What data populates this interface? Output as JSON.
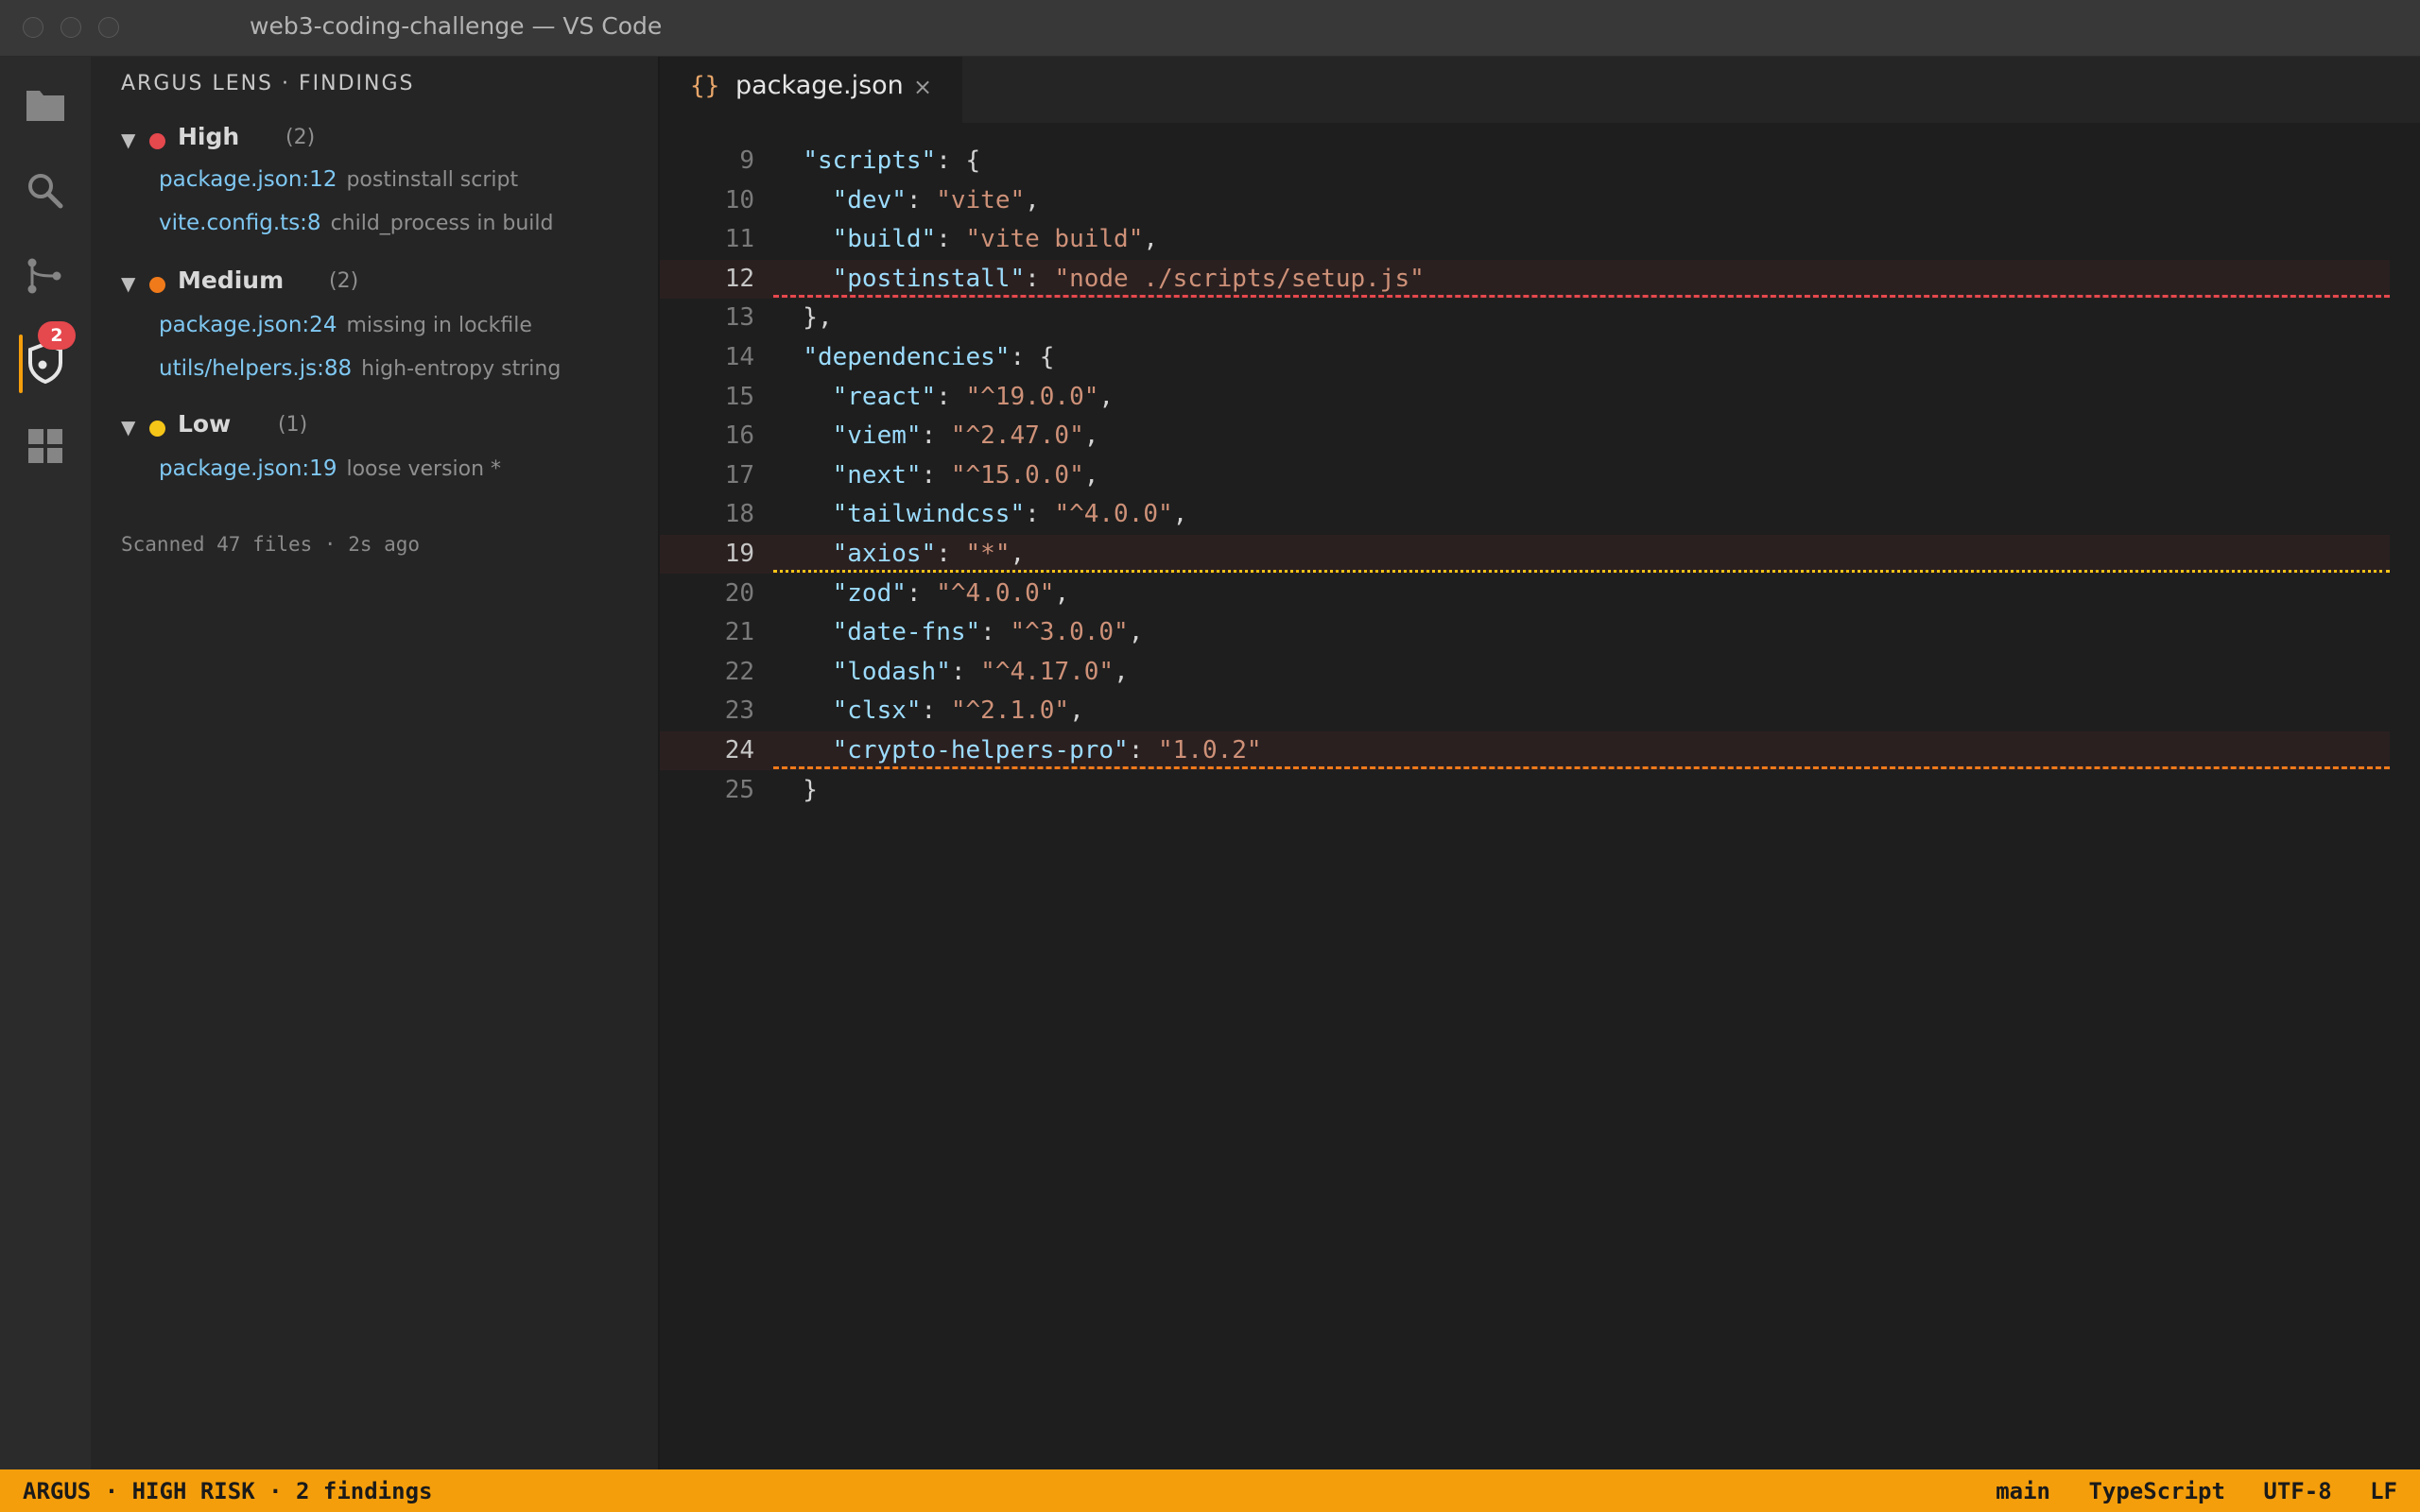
{
  "window": {
    "title": "web3-coding-challenge — VS Code"
  },
  "activity_bar": {
    "items": [
      "files-icon",
      "search-icon",
      "source-control-icon",
      "argus-shield-icon",
      "extensions-icon"
    ],
    "argus_badge": "2"
  },
  "sidebar": {
    "header": "ARGUS LENS · FINDINGS",
    "groups": [
      {
        "label": "High",
        "count": "(2)",
        "color": "#e5484d",
        "items": [
          {
            "location": "package.json:12",
            "description": "postinstall script"
          },
          {
            "location": "vite.config.ts:8",
            "description": "child_process in build"
          }
        ]
      },
      {
        "label": "Medium",
        "count": "(2)",
        "color": "#f07a1a",
        "items": [
          {
            "location": "package.json:24",
            "description": "missing in lockfile"
          },
          {
            "location": "utils/helpers.js:88",
            "description": "high-entropy string"
          }
        ]
      },
      {
        "label": "Low",
        "count": "(1)",
        "color": "#f5c518",
        "items": [
          {
            "location": "package.json:19",
            "description": "loose version *"
          }
        ]
      }
    ],
    "scan_status": "Scanned 47 files · 2s ago"
  },
  "editor": {
    "tab": {
      "icon": "{}",
      "label": "package.json",
      "close": "×"
    },
    "lines": [
      {
        "num": "9",
        "text": "  \"scripts\": {"
      },
      {
        "num": "10",
        "text": "    \"dev\": \"vite\","
      },
      {
        "num": "11",
        "text": "    \"build\": \"vite build\","
      },
      {
        "num": "12",
        "text": "    \"postinstall\": \"node ./scripts/setup.js\"",
        "severity": "high"
      },
      {
        "num": "13",
        "text": "  },"
      },
      {
        "num": "14",
        "text": "  \"dependencies\": {"
      },
      {
        "num": "15",
        "text": "    \"react\": \"^19.0.0\","
      },
      {
        "num": "16",
        "text": "    \"viem\": \"^2.47.0\","
      },
      {
        "num": "17",
        "text": "    \"next\": \"^15.0.0\","
      },
      {
        "num": "18",
        "text": "    \"tailwindcss\": \"^4.0.0\","
      },
      {
        "num": "19",
        "text": "    \"axios\": \"*\",",
        "severity": "low"
      },
      {
        "num": "20",
        "text": "    \"zod\": \"^4.0.0\","
      },
      {
        "num": "21",
        "text": "    \"date-fns\": \"^3.0.0\","
      },
      {
        "num": "22",
        "text": "    \"lodash\": \"^4.17.0\","
      },
      {
        "num": "23",
        "text": "    \"clsx\": \"^2.1.0\","
      },
      {
        "num": "24",
        "text": "    \"crypto-helpers-pro\": \"1.0.2\"",
        "severity": "medium"
      },
      {
        "num": "25",
        "text": "  }"
      }
    ]
  },
  "status_bar": {
    "left": " ARGUS · HIGH RISK · 2 findings",
    "branch": "main",
    "language": "TypeScript",
    "encoding": "UTF-8",
    "eol": "LF",
    "accent": "#f59e0b"
  }
}
